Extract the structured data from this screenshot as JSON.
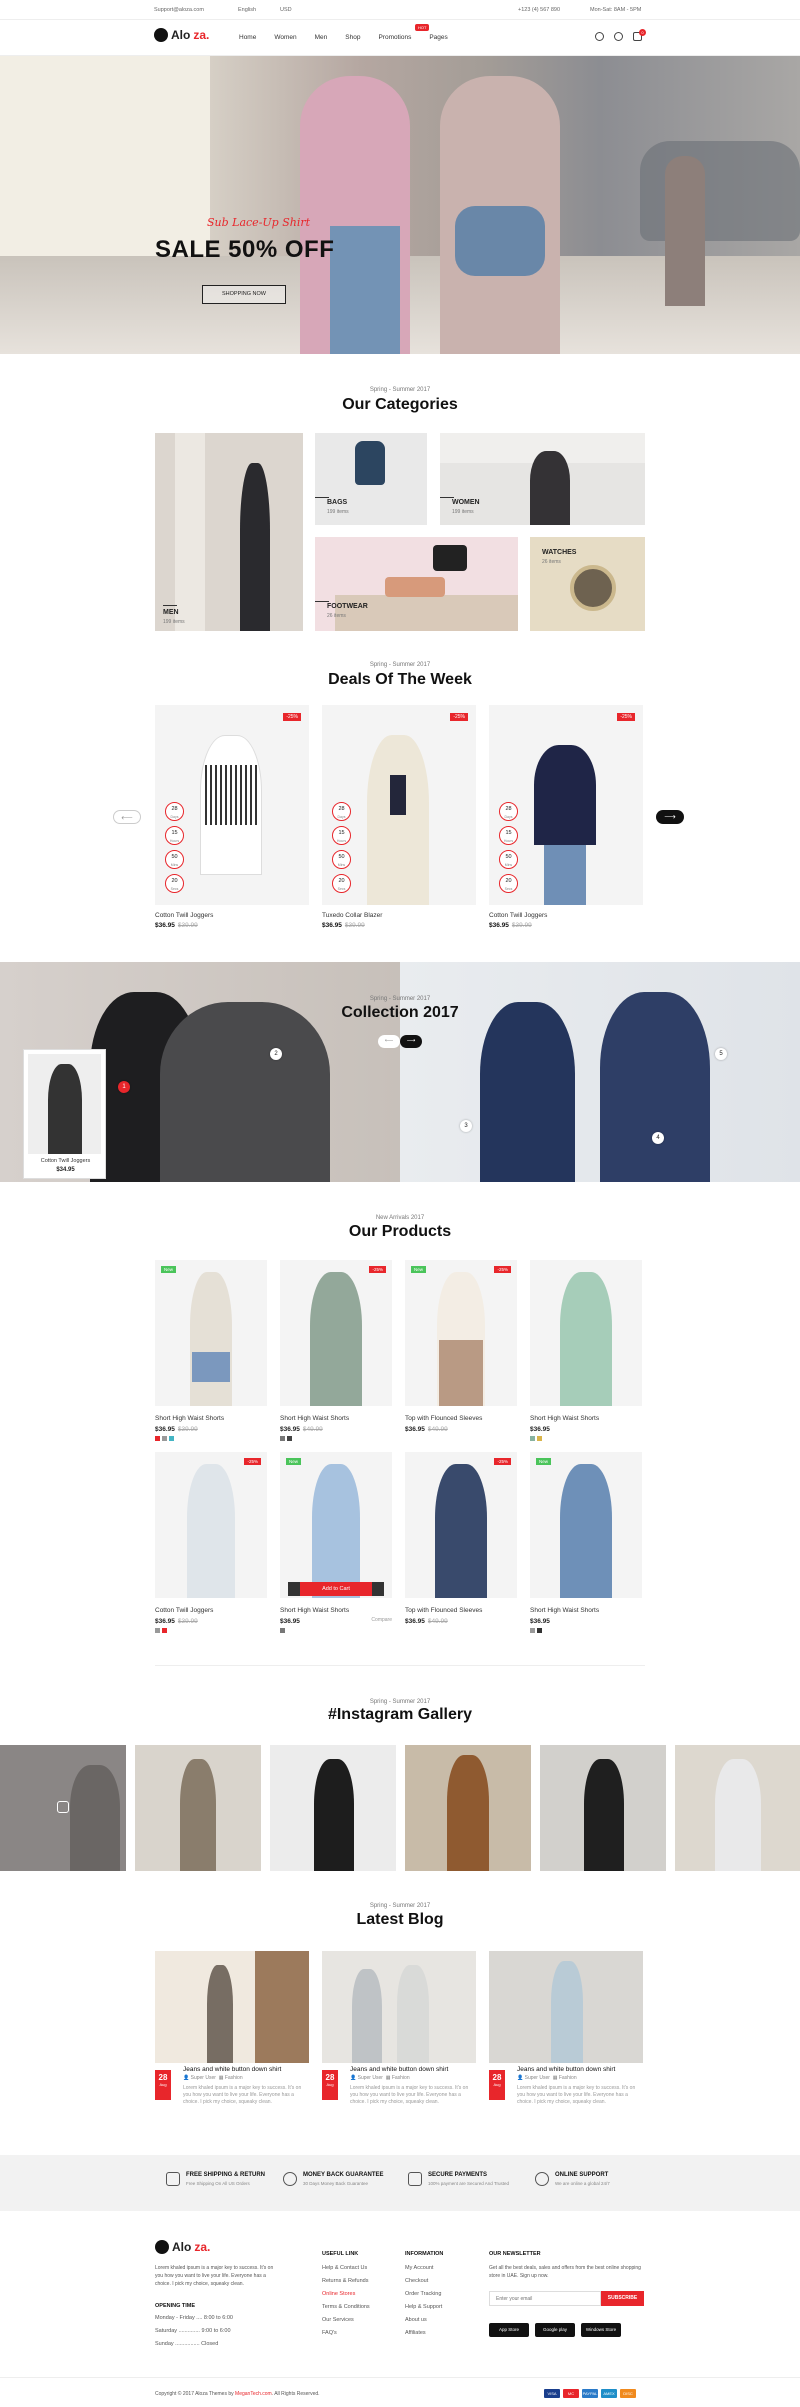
{
  "topbar": {
    "email": "Support@aloza.com",
    "language": "English",
    "currency": "USD",
    "phone": "+123 (4) 567 890",
    "hours": "Mon-Sat: 8AM - 5PM"
  },
  "header": {
    "logo": "Alo",
    "logo_accent": "za.",
    "nav": [
      "Home",
      "Women",
      "Men",
      "Shop",
      "Promotions",
      "Pages"
    ],
    "hot_badge": "HOT",
    "cart_count": "0"
  },
  "hero": {
    "script": "Sub Lace-Up Shirt",
    "title": "SALE 50% OFF",
    "button": "SHOPPING NOW"
  },
  "categories": {
    "subtitle": "Spring - Summer 2017",
    "title": "Our Categories",
    "items": [
      {
        "label": "MEN",
        "count": "199 items"
      },
      {
        "label": "BAGS",
        "count": "199 items"
      },
      {
        "label": "WOMEN",
        "count": "199 items"
      },
      {
        "label": "FOOTWEAR",
        "count": "26 items"
      },
      {
        "label": "WATCHES",
        "count": "26 items"
      }
    ]
  },
  "deals": {
    "subtitle": "Spring - Summer 2017",
    "title": "Deals Of The Week",
    "items": [
      {
        "name": "Cotton Twill Joggers",
        "price": "$36.95",
        "old": "$39.99",
        "badge": "-25%"
      },
      {
        "name": "Tuxedo Collar Blazer",
        "price": "$36.95",
        "old": "$39.99",
        "badge": "-25%"
      },
      {
        "name": "Cotton Twill Joggers",
        "price": "$36.95",
        "old": "$39.99",
        "badge": "-25%"
      }
    ],
    "timer": [
      {
        "v": "28",
        "u": "Days"
      },
      {
        "v": "15",
        "u": "Hours"
      },
      {
        "v": "50",
        "u": "Mins"
      },
      {
        "v": "20",
        "u": "Secs"
      }
    ]
  },
  "collection": {
    "subtitle": "Spring - Summer 2017",
    "title": "Collection 2017",
    "popup_name": "Cotton Twill Joggers",
    "popup_price": "$34.95",
    "hotspots": [
      "1",
      "2",
      "3",
      "4",
      "5"
    ]
  },
  "products": {
    "subtitle": "New Arrivals 2017",
    "title": "Our Products",
    "add_to_cart": "Add to Cart",
    "compare": "Compare",
    "items": [
      {
        "name": "Short High Waist Shorts",
        "price": "$36.95",
        "old": "$39.99",
        "new": "New",
        "pct": ""
      },
      {
        "name": "Short High Waist Shorts",
        "price": "$36.95",
        "old": "$49.99",
        "new": "",
        "pct": "-25%"
      },
      {
        "name": "Top with Flounced Sleeves",
        "price": "$36.95",
        "old": "$49.99",
        "new": "New",
        "pct": "-25%"
      },
      {
        "name": "Short High Waist Shorts",
        "price": "$36.95",
        "old": "",
        "new": "",
        "pct": ""
      },
      {
        "name": "Cotton Twill Joggers",
        "price": "$36.95",
        "old": "$39.99",
        "new": "",
        "pct": "-25%"
      },
      {
        "name": "Short High Waist Shorts",
        "price": "$36.95",
        "old": "",
        "new": "New",
        "pct": ""
      },
      {
        "name": "Top with Flounced Sleeves",
        "price": "$36.95",
        "old": "$49.99",
        "new": "",
        "pct": "-25%"
      },
      {
        "name": "Short High Waist Shorts",
        "price": "$36.95",
        "old": "",
        "new": "New",
        "pct": ""
      }
    ]
  },
  "instagram": {
    "subtitle": "Spring - Summer 2017",
    "title": "#Instagram Gallery"
  },
  "blog": {
    "subtitle": "Spring - Summer 2017",
    "title": "Latest Blog",
    "posts": [
      {
        "day": "28",
        "month": "Aug",
        "title": "Jeans and white button down shirt",
        "author": "Super User",
        "category": "Fashion",
        "excerpt": "Lorem khaled ipsum is a major key to success. It's on you how you want to live your life. Everyone has a choice. I pick my choice, squeaky clean."
      },
      {
        "day": "28",
        "month": "Aug",
        "title": "Jeans and white button down shirt",
        "author": "Super User",
        "category": "Fashion",
        "excerpt": "Lorem khaled ipsum is a major key to success. It's on you how you want to live your life. Everyone has a choice. I pick my choice, squeaky clean."
      },
      {
        "day": "28",
        "month": "Aug",
        "title": "Jeans and white button down shirt",
        "author": "Super User",
        "category": "Fashion",
        "excerpt": "Lorem khaled ipsum is a major key to success. It's on you how you want to live your life. Everyone has a choice. I pick my choice, squeaky clean."
      }
    ]
  },
  "services": [
    {
      "title": "FREE SHIPPING & RETURN",
      "text": "Free Shipping On All US Orders"
    },
    {
      "title": "MONEY BACK GUARANTEE",
      "text": "30 Days Money Back Guarantee"
    },
    {
      "title": "SECURE PAYMENTS",
      "text": "100% payment are Secured And Trusted"
    },
    {
      "title": "ONLINE SUPPORT",
      "text": "We are online a global 24/7"
    }
  ],
  "footer": {
    "about": "Lorem khaled ipsum is a major key to success. It's on you how you want to live your life. Everyone has a choice. I pick my choice, squeaky clean.",
    "opening_title": "OPENING TIME",
    "opening": [
      "Monday - Friday .... 8:00 to 6:00",
      "Saturday .............. 9:00 to 6:00",
      "Sunday ................ Closed"
    ],
    "useful_title": "USEFUL LINK",
    "useful": [
      "Help & Contact Us",
      "Returns & Refunds",
      "Online Stores",
      "Terms & Conditions",
      "Our Services",
      "FAQ's"
    ],
    "info_title": "INFORMATION",
    "info": [
      "My Account",
      "Checkout",
      "Order Tracking",
      "Help & Support",
      "About us",
      "Affiliates"
    ],
    "newsletter_title": "OUR NEWSLETTER",
    "newsletter_text": "Get all the best deals, sales and offers from the best online shopping store in UAE. Sign up now.",
    "newsletter_placeholder": "Enter your email",
    "subscribe": "SUBSCRIBE",
    "stores": [
      "App Store",
      "Google play",
      "Windows Store"
    ],
    "copyright": "Copyright © 2017 Aloza Themes by",
    "copyright_link": "MeganTech.com",
    "copyright_end": ". All Rights Reserved.",
    "payments": [
      "VISA",
      "MC",
      "PAYPAL",
      "AMEX",
      "DISC"
    ]
  }
}
